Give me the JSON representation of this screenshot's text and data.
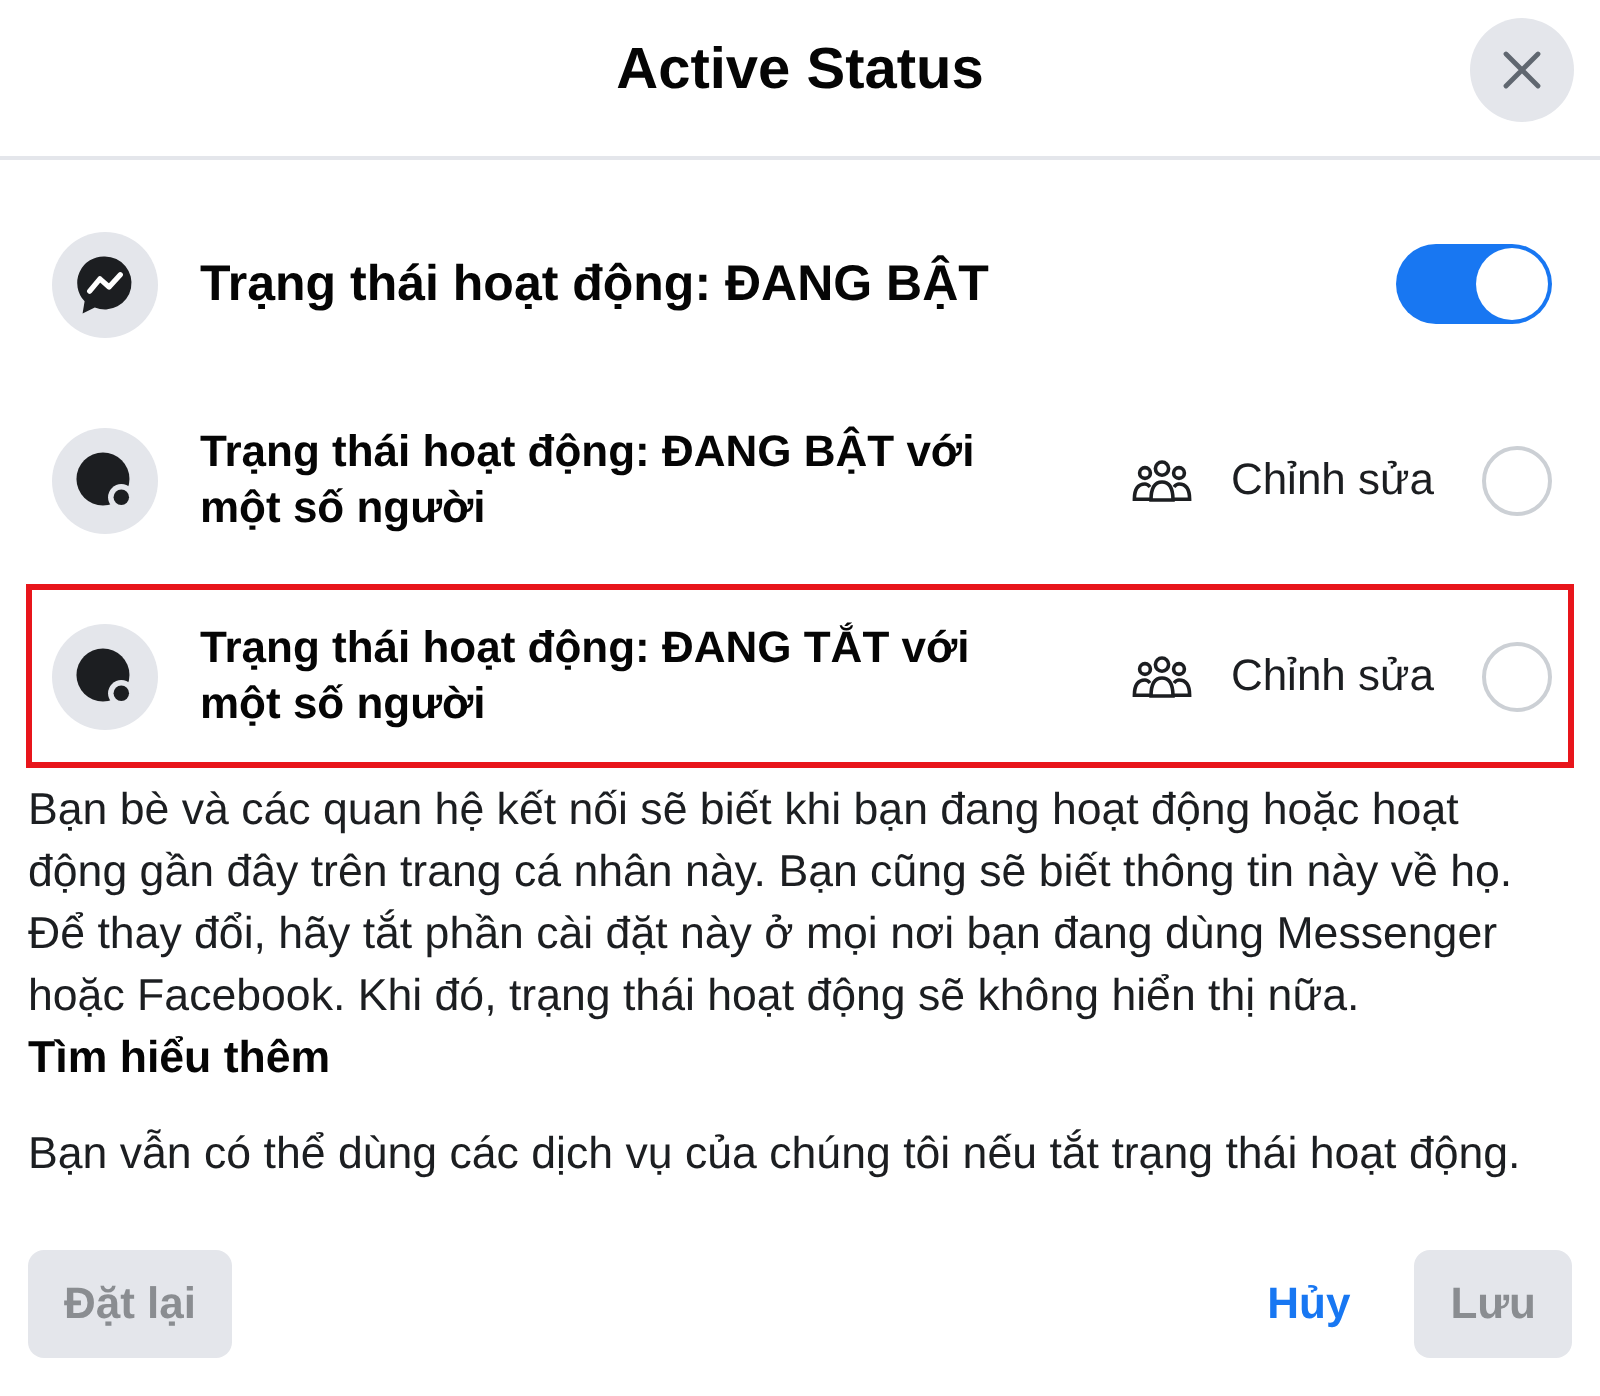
{
  "dialog": {
    "title": "Active Status"
  },
  "options": [
    {
      "kind": "toggle",
      "label": "Trạng thái hoạt động: ĐANG BẬT",
      "on": true,
      "highlighted": false
    },
    {
      "kind": "radio",
      "label": "Trạng thái hoạt động: ĐANG BẬT với một số người",
      "edit_label": "Chỉnh sửa",
      "selected": false,
      "highlighted": false
    },
    {
      "kind": "radio",
      "label": "Trạng thái hoạt động: ĐANG TẮT với một số người",
      "edit_label": "Chỉnh sửa",
      "selected": false,
      "highlighted": true
    }
  ],
  "description": {
    "text": "Bạn bè và các quan hệ kết nối sẽ biết khi bạn đang hoạt động hoặc hoạt động gần đây trên trang cá nhân này. Bạn cũng sẽ biết thông tin này về họ. Để thay đổi, hãy tắt phần cài đặt này ở mọi nơi bạn đang dùng Messenger hoặc Facebook. Khi đó, trạng thái hoạt động sẽ không hiển thị nữa.",
    "link": "Tìm hiểu thêm"
  },
  "note": "Bạn vẫn có thể dùng các dịch vụ của chúng tôi nếu tắt trạng thái hoạt động.",
  "footer": {
    "left": [
      {
        "kind": "filled",
        "label": "Đặt lại",
        "disabled": true
      }
    ],
    "right": [
      {
        "kind": "text",
        "label": "Hủy",
        "disabled": false
      },
      {
        "kind": "filled",
        "label": "Lưu",
        "disabled": true
      }
    ]
  }
}
